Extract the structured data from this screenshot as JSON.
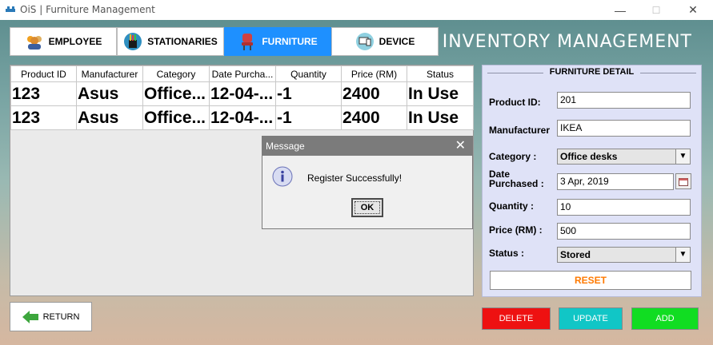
{
  "window": {
    "title": "OiS | Furniture Management",
    "minimize": "—",
    "maximize": "☐",
    "close": "✕"
  },
  "header": {
    "title": "INVENTORY MANAGEMENT"
  },
  "tabs": [
    {
      "label": "EMPLOYEE",
      "icon": "employee-icon"
    },
    {
      "label": "STATIONARIES",
      "icon": "stationaries-icon"
    },
    {
      "label": "FURNITURE",
      "icon": "furniture-icon",
      "active": true
    },
    {
      "label": "DEVICE",
      "icon": "device-icon"
    }
  ],
  "table": {
    "columns": [
      "Product ID",
      "Manufacturer",
      "Category",
      "Date Purcha...",
      "Quantity",
      "Price (RM)",
      "Status"
    ],
    "rows": [
      [
        "123",
        "Asus",
        "Office...",
        "12-04-...",
        "-1",
        "2400",
        "In Use"
      ],
      [
        "123",
        "Asus",
        "Office...",
        "12-04-...",
        "-1",
        "2400",
        "In Use"
      ]
    ]
  },
  "detail": {
    "heading": "FURNITURE DETAIL",
    "product_id_label": "Product ID:",
    "product_id_value": "201",
    "manufacturer_label": "Manufacturer",
    "manufacturer_value": "IKEA",
    "category_label": "Category :",
    "category_value": "Office desks",
    "date_label_line1": "Date",
    "date_label_line2": "Purchased :",
    "date_value": "3 Apr, 2019",
    "quantity_label": "Quantity :",
    "quantity_value": "10",
    "price_label": "Price (RM) :",
    "price_value": "500",
    "status_label": "Status :",
    "status_value": "Stored",
    "reset_label": "RESET"
  },
  "buttons": {
    "return_label": "RETURN",
    "delete_label": "DELETE",
    "update_label": "UPDATE",
    "add_label": "ADD"
  },
  "dialog": {
    "title": "Message",
    "message": "Register Successfully!",
    "ok_label": "OK"
  },
  "colors": {
    "active_tab": "#1e90ff",
    "delete": "#ee1111",
    "update": "#11c6c6",
    "add": "#11dd22",
    "reset": "#ff7a00"
  }
}
